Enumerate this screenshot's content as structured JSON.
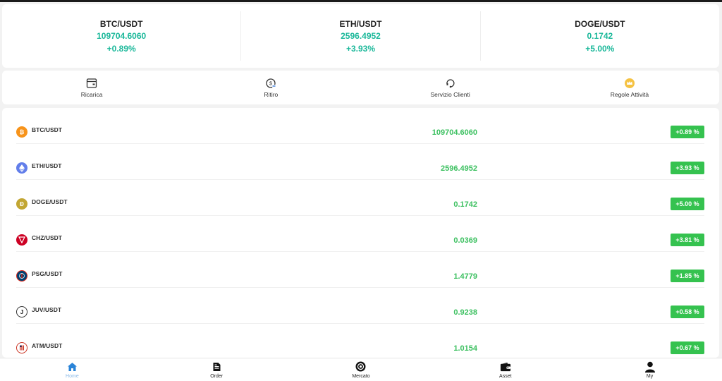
{
  "tickers": [
    {
      "symbol": "BTC/USDT",
      "price": "109704.6060",
      "change": "+0.89%"
    },
    {
      "symbol": "ETH/USDT",
      "price": "2596.4952",
      "change": "+3.93%"
    },
    {
      "symbol": "DOGE/USDT",
      "price": "0.1742",
      "change": "+5.00%"
    }
  ],
  "actions": [
    {
      "label": "Ricarica",
      "icon": "wallet-card-icon"
    },
    {
      "label": "Ritiro",
      "icon": "withdraw-icon"
    },
    {
      "label": "Servizio Clienti",
      "icon": "support-icon"
    },
    {
      "label": "Regole Attività",
      "icon": "crown-icon"
    }
  ],
  "market": [
    {
      "pair": "BTC/USDT",
      "price": "109704.6060",
      "change": "+0.89 %",
      "icon": "bitcoin-icon",
      "color": "#f7931a"
    },
    {
      "pair": "ETH/USDT",
      "price": "2596.4952",
      "change": "+3.93 %",
      "icon": "ethereum-icon",
      "color": "#627eea"
    },
    {
      "pair": "DOGE/USDT",
      "price": "0.1742",
      "change": "+5.00 %",
      "icon": "dogecoin-icon",
      "color": "#c2a633"
    },
    {
      "pair": "CHZ/USDT",
      "price": "0.0369",
      "change": "+3.81 %",
      "icon": "chiliz-icon",
      "color": "#cd0124"
    },
    {
      "pair": "PSG/USDT",
      "price": "1.4779",
      "change": "+1.85 %",
      "icon": "psg-icon",
      "color": "#004170"
    },
    {
      "pair": "JUV/USDT",
      "price": "0.9238",
      "change": "+0.58 %",
      "icon": "juventus-icon",
      "color": "#ffffff"
    },
    {
      "pair": "ATM/USDT",
      "price": "1.0154",
      "change": "+0.67 %",
      "icon": "atletico-icon",
      "color": "#cb3524"
    }
  ],
  "nav": [
    {
      "label": "Home",
      "icon": "home-icon",
      "active": true
    },
    {
      "label": "Order",
      "icon": "document-icon",
      "active": false
    },
    {
      "label": "Mercato",
      "icon": "market-icon",
      "active": false
    },
    {
      "label": "Asset",
      "icon": "wallet-icon",
      "active": false
    },
    {
      "label": "My",
      "icon": "user-icon",
      "active": false
    }
  ],
  "colors": {
    "accent_green": "#35c24f",
    "ticker_teal": "#1bb89a",
    "nav_active": "#8ab9e6"
  }
}
